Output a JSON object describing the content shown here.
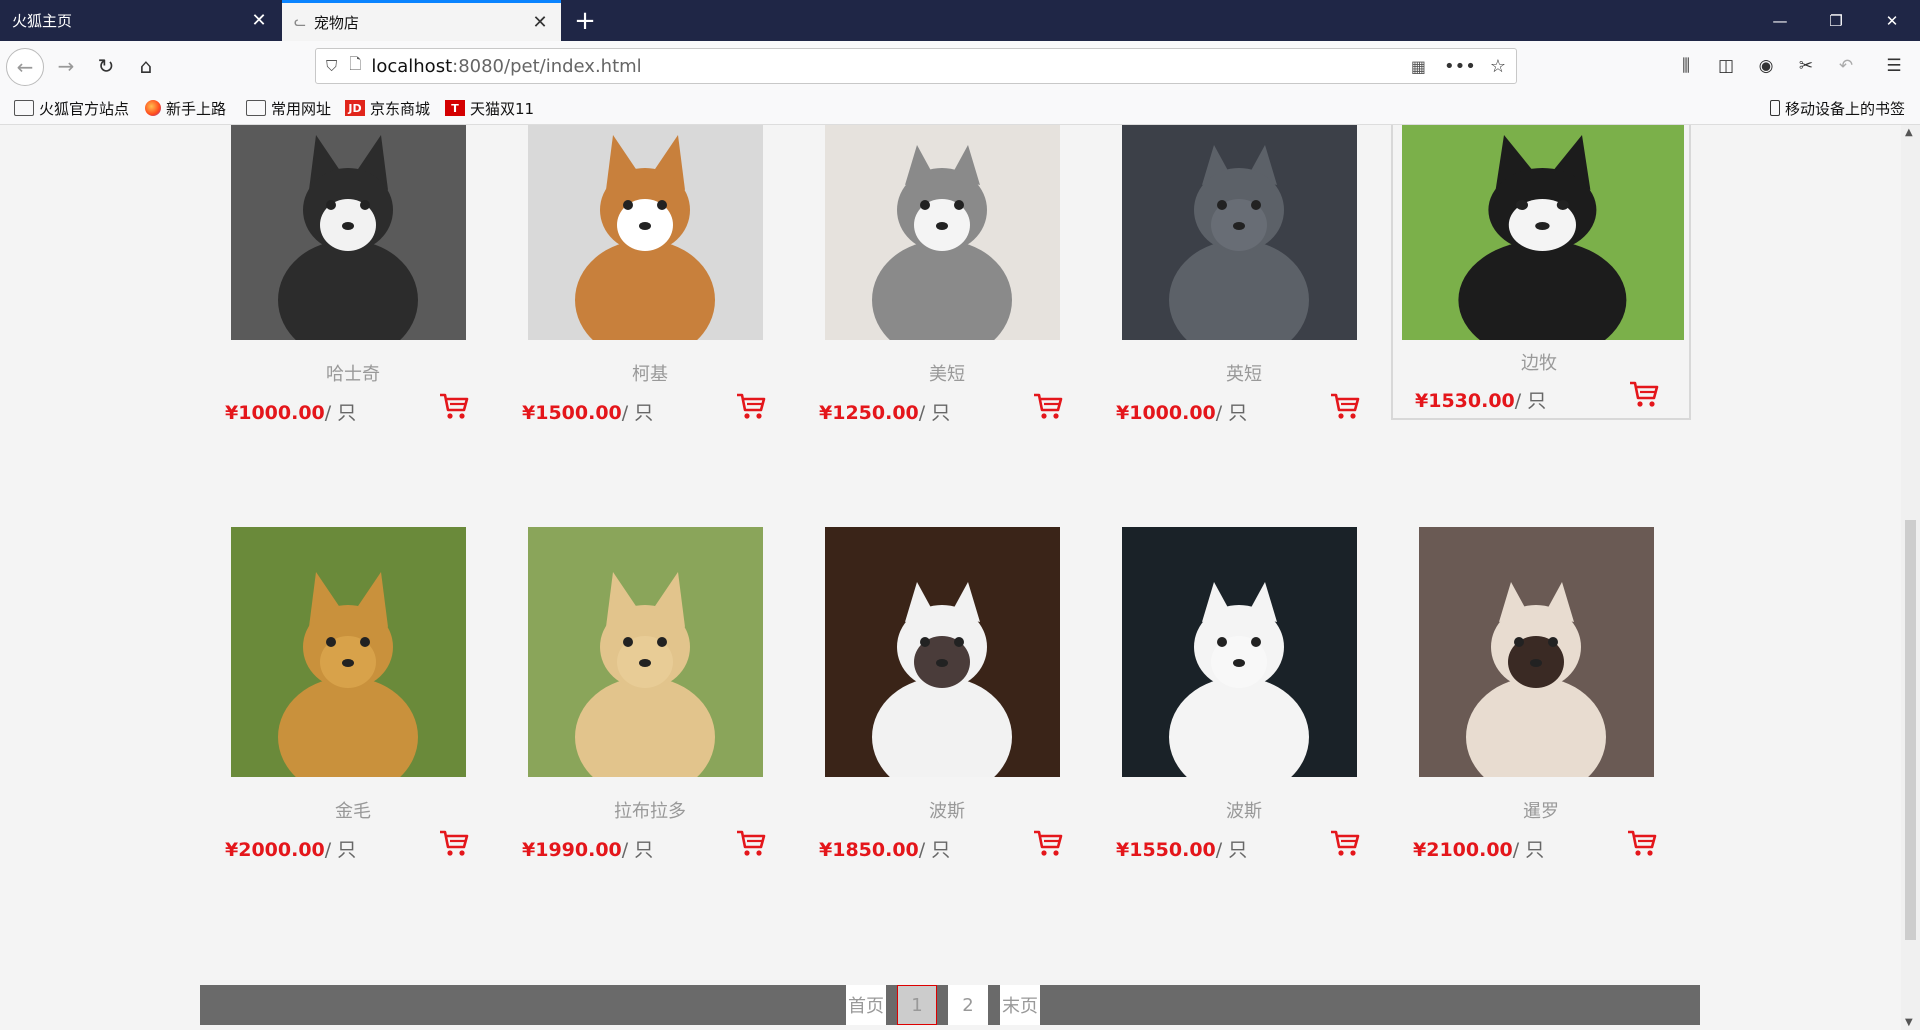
{
  "browser": {
    "tabs": [
      {
        "title": "火狐主页",
        "active": false
      },
      {
        "title": "宠物店",
        "active": true
      }
    ],
    "url": {
      "host": "localhost",
      "path": ":8080/pet/index.html"
    },
    "bookmarks": [
      {
        "label": "火狐官方站点",
        "icon": "folder-icon"
      },
      {
        "label": "新手上路",
        "icon": "firefox-icon"
      },
      {
        "label": "常用网址",
        "icon": "folder-icon"
      },
      {
        "label": "京东商城",
        "icon": "jd-icon"
      },
      {
        "label": "天猫双11",
        "icon": "tmall-icon"
      }
    ],
    "mobile_bookmarks": "移动设备上的书签"
  },
  "products": [
    {
      "name": "哈士奇",
      "price": "¥1000.00",
      "unit": "/ 只",
      "image": "husky"
    },
    {
      "name": "柯基",
      "price": "¥1500.00",
      "unit": "/ 只",
      "image": "corgi"
    },
    {
      "name": "美短",
      "price": "¥1250.00",
      "unit": "/ 只",
      "image": "american-shorthair"
    },
    {
      "name": "英短",
      "price": "¥1000.00",
      "unit": "/ 只",
      "image": "british-shorthair"
    },
    {
      "name": "边牧",
      "price": "¥1530.00",
      "unit": "/ 只",
      "image": "border-collie",
      "hovered": true
    },
    {
      "name": "金毛",
      "price": "¥2000.00",
      "unit": "/ 只",
      "image": "golden-retriever"
    },
    {
      "name": "拉布拉多",
      "price": "¥1990.00",
      "unit": "/ 只",
      "image": "labrador"
    },
    {
      "name": "波斯",
      "price": "¥1850.00",
      "unit": "/ 只",
      "image": "ragdoll-cat"
    },
    {
      "name": "波斯",
      "price": "¥1550.00",
      "unit": "/ 只",
      "image": "persian-cat"
    },
    {
      "name": "暹罗",
      "price": "¥2100.00",
      "unit": "/ 只",
      "image": "siamese-cat"
    }
  ],
  "pagination": {
    "first": "首页",
    "pages": [
      "1",
      "2"
    ],
    "current": "1",
    "last": "末页"
  },
  "colors": {
    "price": "#e4161b",
    "tabbar": "#1f2646",
    "pagination_bar": "#6a6a6a"
  }
}
